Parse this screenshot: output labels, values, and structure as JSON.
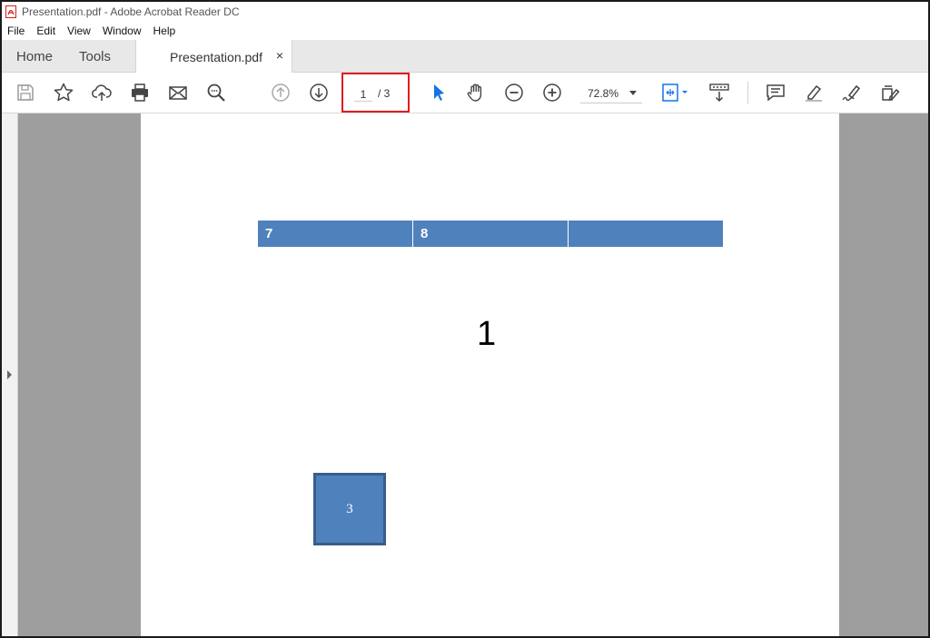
{
  "window": {
    "title": "Presentation.pdf - Adobe Acrobat Reader DC"
  },
  "menubar": {
    "items": [
      "File",
      "Edit",
      "View",
      "Window",
      "Help"
    ]
  },
  "tabs": {
    "home": "Home",
    "tools": "Tools",
    "document": "Presentation.pdf",
    "close": "×"
  },
  "toolbar": {
    "icons": [
      "save-icon",
      "star-icon",
      "upload-icon",
      "print-icon",
      "email-icon",
      "find-icon",
      "prev-page-icon",
      "next-page-icon",
      "select-arrow-icon",
      "hand-icon",
      "zoom-out-icon",
      "zoom-in-icon",
      "fit-page-icon",
      "scroll-mode-icon",
      "comment-icon",
      "highlight-icon",
      "sign-icon",
      "fill-sign-icon"
    ],
    "page_current": "1",
    "page_total": "/ 3",
    "zoom": "72.8%",
    "accent_color": "#1473e6",
    "highlight_color": "#e01c1c"
  },
  "document": {
    "table_cells": [
      "7",
      "8",
      ""
    ],
    "table_color": "#4f81bd",
    "big_number": "1",
    "box_label": "3"
  }
}
